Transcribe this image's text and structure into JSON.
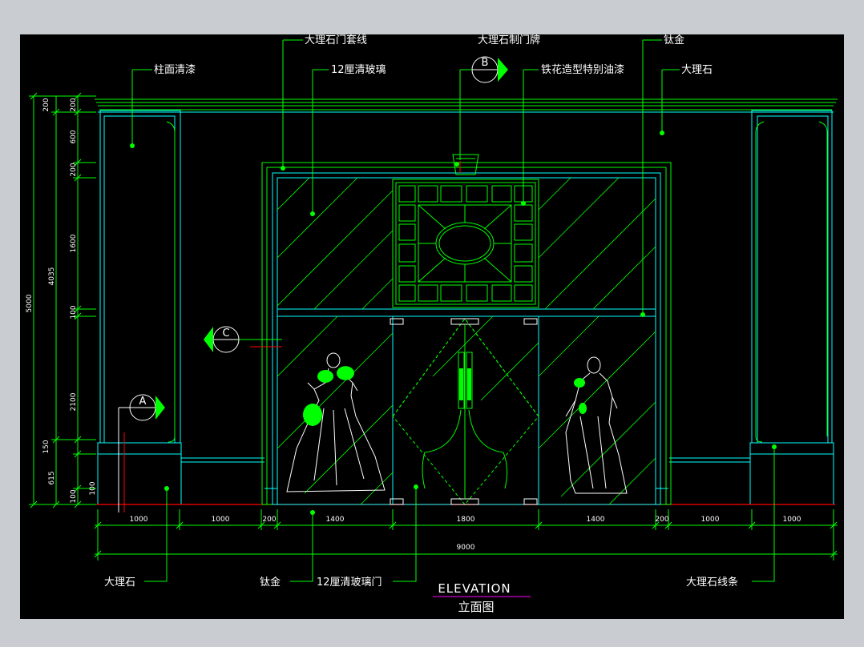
{
  "drawing": {
    "title": "ELEVATION",
    "subtitle": "立面图"
  },
  "callouts": {
    "marble_door_frame": "大理石门套线",
    "marble_door_plate": "大理石制门牌",
    "titanium_gold_top": "钛金",
    "column_varnish": "柱面清漆",
    "glass_12mm": "12厘清玻璃",
    "wrought_iron_paint": "铁花造型特别油漆",
    "marble_top": "大理石",
    "marble_bottom": "大理石",
    "titanium_gold_bottom": "钛金",
    "glass_door_12mm": "12厘清玻璃门",
    "marble_strip": "大理石线条"
  },
  "section_marks": {
    "a": "A",
    "b": "B",
    "c": "C"
  },
  "vertical_dims": {
    "outer": [
      "200",
      "4035",
      "5000"
    ],
    "segments": [
      "200",
      "600",
      "200",
      "1600",
      "100",
      "2100",
      "150",
      "615",
      "100",
      "100"
    ]
  },
  "horizontal_dims": {
    "segments": [
      "1000",
      "1000",
      "200",
      "1400",
      "1800",
      "1400",
      "200",
      "1000",
      "1000"
    ],
    "total": "9000"
  },
  "colors": {
    "background": "#000000",
    "frame_gray": "#c9cdd2",
    "line_green": "#00ff00",
    "line_cyan": "#00ffff",
    "floor_red": "#ff0000",
    "title_underline": "#ff00ff"
  }
}
